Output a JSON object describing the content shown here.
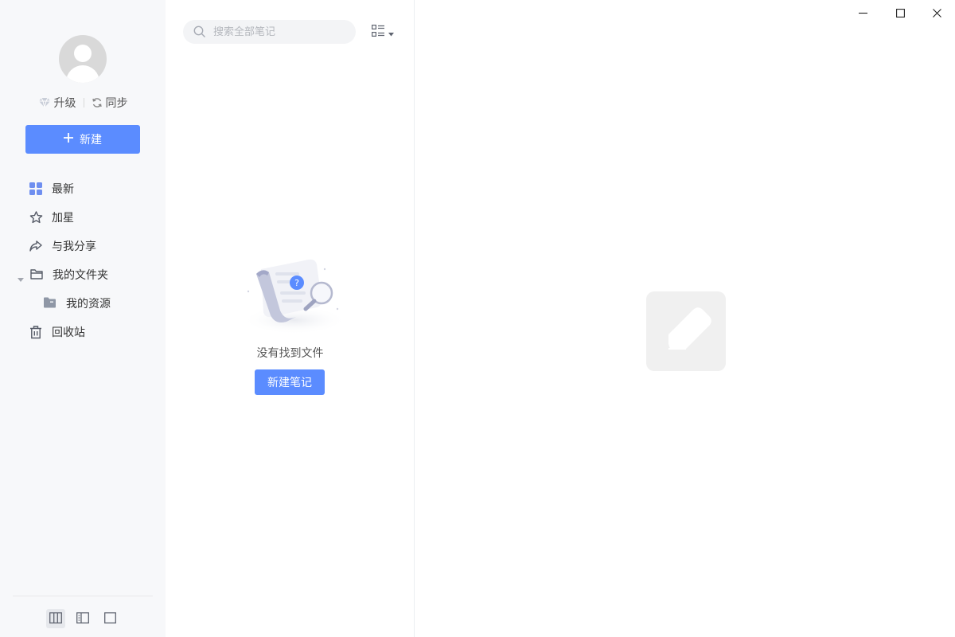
{
  "sidebar": {
    "upgrade_label": "升级",
    "sync_label": "同步",
    "new_label": "新建",
    "items": [
      {
        "label": "最新",
        "icon": "grid-icon"
      },
      {
        "label": "加星",
        "icon": "star-icon"
      },
      {
        "label": "与我分享",
        "icon": "share-icon"
      },
      {
        "label": "我的文件夹",
        "icon": "folder-open-icon"
      },
      {
        "label": "我的资源",
        "icon": "folder-icon"
      },
      {
        "label": "回收站",
        "icon": "trash-icon"
      }
    ],
    "layout_modes": [
      "three-column",
      "two-column",
      "single-column"
    ],
    "active_layout": "three-column"
  },
  "list": {
    "search_placeholder": "搜索全部笔记",
    "empty_text": "没有找到文件",
    "create_note_label": "新建笔记"
  },
  "colors": {
    "accent": "#5b8cff",
    "sidebar_bg": "#f7f8fa",
    "icon_blue": "#6f8ff0"
  }
}
